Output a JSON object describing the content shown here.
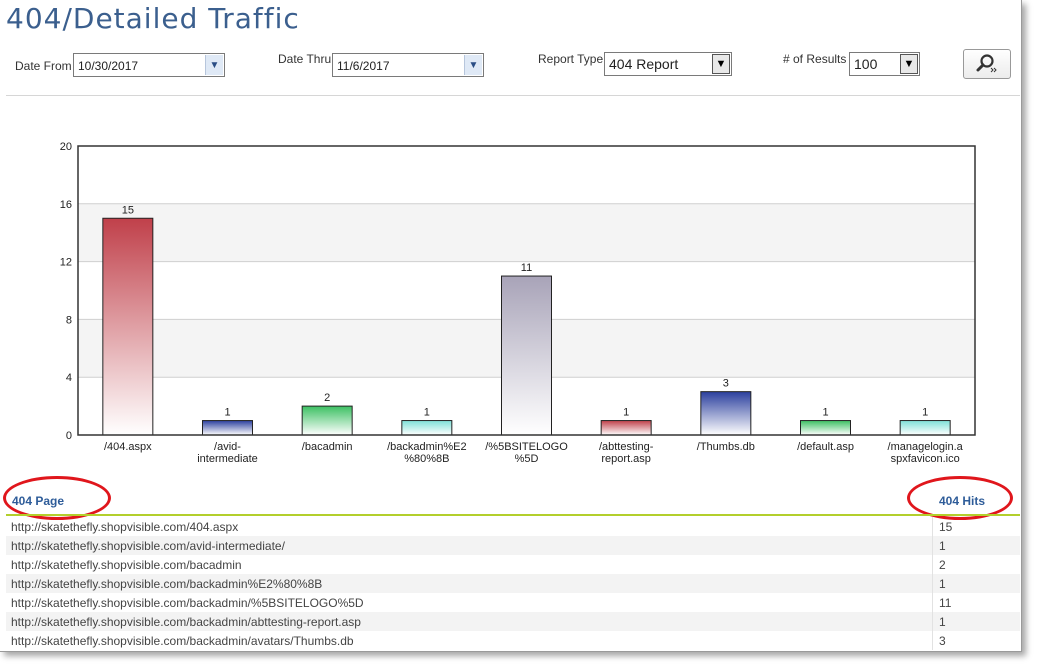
{
  "title": "404/Detailed Traffic",
  "filters": {
    "date_from_label": "Date From",
    "date_from_value": "10/30/2017",
    "date_thru_label": "Date Thru",
    "date_thru_value": "11/6/2017",
    "report_type_label": "Report Type",
    "report_type_value": "404 Report",
    "results_label": "# of Results",
    "results_value": "100"
  },
  "icons": {
    "search": "search-icon"
  },
  "chart_data": {
    "type": "bar",
    "categories": [
      [
        "/404.aspx"
      ],
      [
        "/avid-",
        "intermediate"
      ],
      [
        "/bacadmin"
      ],
      [
        "/backadmin%E2",
        "%80%8B"
      ],
      [
        "/%5BSITELOGO",
        "%5D"
      ],
      [
        "/abttesting-",
        "report.asp"
      ],
      [
        "/Thumbs.db"
      ],
      [
        "/default.asp"
      ],
      [
        "/managelogin.a",
        "spxfavicon.ico"
      ]
    ],
    "values": [
      15,
      1,
      2,
      1,
      11,
      1,
      3,
      1,
      1
    ],
    "colors": [
      "#c0404a",
      "#2b3f9e",
      "#3cc062",
      "#7ee0d8",
      "#a8a3b8",
      "#c0404a",
      "#2b3f9e",
      "#3cc062",
      "#7ee0d8"
    ],
    "yticks": [
      0,
      4,
      8,
      12,
      16,
      20
    ],
    "ylim": [
      0,
      20
    ],
    "grid": true
  },
  "table": {
    "col_page": "404 Page",
    "col_hits": "404 Hits",
    "rows": [
      {
        "url": "http://skatethefly.shopvisible.com/404.aspx",
        "hits": "15"
      },
      {
        "url": "http://skatethefly.shopvisible.com/avid-intermediate/",
        "hits": "1"
      },
      {
        "url": "http://skatethefly.shopvisible.com/bacadmin",
        "hits": "2"
      },
      {
        "url": "http://skatethefly.shopvisible.com/backadmin%E2%80%8B",
        "hits": "1"
      },
      {
        "url": "http://skatethefly.shopvisible.com/backadmin/%5BSITELOGO%5D",
        "hits": "11"
      },
      {
        "url": "http://skatethefly.shopvisible.com/backadmin/abttesting-report.asp",
        "hits": "1"
      },
      {
        "url": "http://skatethefly.shopvisible.com/backadmin/avatars/Thumbs.db",
        "hits": "3"
      }
    ]
  }
}
